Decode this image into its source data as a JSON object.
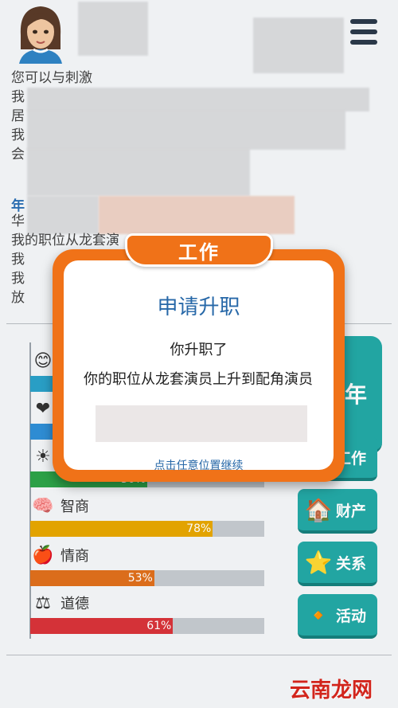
{
  "header": {
    "avatar": "avatar-woman",
    "menu_icon": "menu-icon"
  },
  "story": {
    "lines": [
      "您可以与刺激",
      "我",
      "居",
      "我",
      "会"
    ],
    "year_label": "年",
    "lines2": [
      "华",
      "我的职位从龙套演",
      "我",
      "我",
      "放"
    ]
  },
  "stats": [
    {
      "name": "",
      "icon": "smile-icon",
      "pct": "",
      "value": null,
      "color": "#2aa2c9"
    },
    {
      "name": "",
      "icon": "heart-icon",
      "pct": "",
      "value": null,
      "color": "#2f8fd8"
    },
    {
      "name": "",
      "icon": "sun-icon",
      "pct": "50%",
      "value": 50,
      "color": "#2da449"
    },
    {
      "name": "智商",
      "icon": "brain-icon",
      "pct": "78%",
      "value": 78,
      "color": "#e7a700"
    },
    {
      "name": "情商",
      "icon": "apple-icon",
      "pct": "53%",
      "value": 53,
      "color": "#e0701c"
    },
    {
      "name": "道德",
      "icon": "scales-icon",
      "pct": "61%",
      "value": 61,
      "color": "#d9343a"
    }
  ],
  "sidebar": {
    "year_text": "年",
    "buttons": [
      {
        "label": "工作",
        "icon": "briefcase-icon"
      },
      {
        "label": "财产",
        "icon": "house-icon"
      },
      {
        "label": "关系",
        "icon": "star-icon"
      },
      {
        "label": "活动",
        "icon": "dots-icon"
      }
    ]
  },
  "dialog": {
    "tab": "工作",
    "title": "申请升职",
    "message1": "你升职了",
    "message2": "你的职位从龙套演员上升到配角演员",
    "hint": "点击任意位置继续"
  },
  "watermark": "云南龙网"
}
